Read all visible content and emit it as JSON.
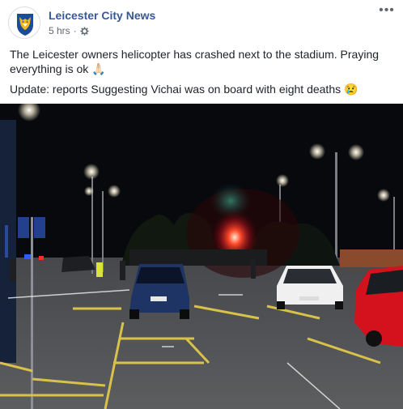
{
  "post": {
    "page_name": "Leicester City News",
    "time": "5 hrs",
    "privacy_icon": "globe-gear-icon",
    "more_icon": "more-options-icon",
    "text_line1": "The Leicester owners helicopter has crashed next to the stadium. Praying everything is ok",
    "text_line1_emoji": "🙏🏻",
    "text_line2": "Update: reports Suggesting Vichai was on board with eight deaths",
    "text_line2_emoji": "😢"
  },
  "photo": {
    "subject": "night-car-park-with-fire",
    "car_plate": "EY66 BLN"
  },
  "colors": {
    "link": "#385898",
    "meta": "#606770",
    "text": "#1d2129",
    "avatar_blue": "#1b4b9b",
    "avatar_gold": "#f3b61f"
  }
}
